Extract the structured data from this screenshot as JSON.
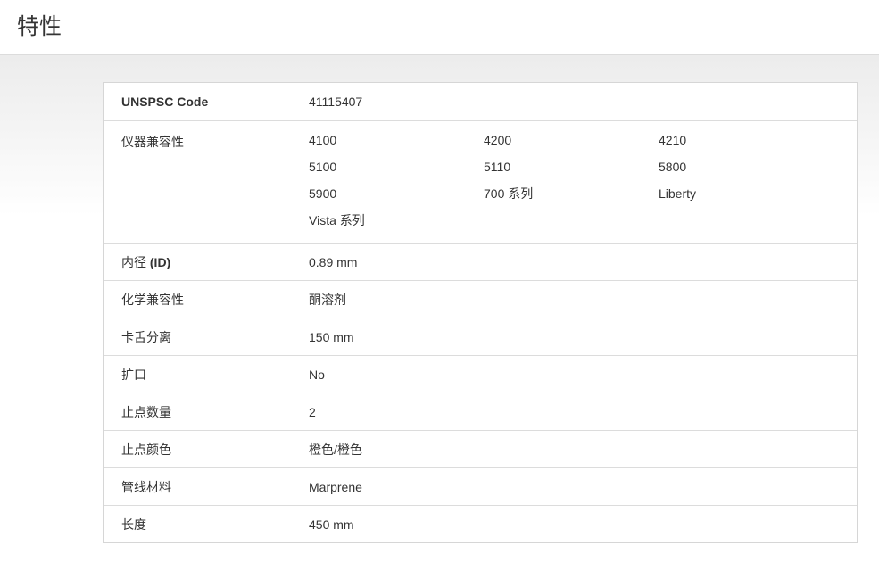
{
  "page": {
    "title": "特性"
  },
  "specs": {
    "unspsc": {
      "label": "UNSPSC Code",
      "value": "41115407"
    },
    "instrument_compat": {
      "label": "仪器兼容性",
      "values": [
        "4100",
        "4200",
        "4210",
        "5100",
        "5110",
        "5800",
        "5900",
        "700 系列",
        "Liberty",
        "Vista 系列"
      ]
    },
    "inner_diameter": {
      "label_prefix": "内径 ",
      "label_bold": "(ID)",
      "value": "0.89 mm"
    },
    "chem_compat": {
      "label": "化学兼容性",
      "value": "酮溶剂"
    },
    "clip_separation": {
      "label": "卡舌分离",
      "value": "150 mm"
    },
    "flared": {
      "label": "扩口",
      "value": "No"
    },
    "stop_count": {
      "label": "止点数量",
      "value": "2"
    },
    "stop_color": {
      "label": "止点颜色",
      "value": "橙色/橙色"
    },
    "tubing_material": {
      "label": "管线材料",
      "value": "Marprene"
    },
    "length": {
      "label": "长度",
      "value": "450 mm"
    }
  }
}
